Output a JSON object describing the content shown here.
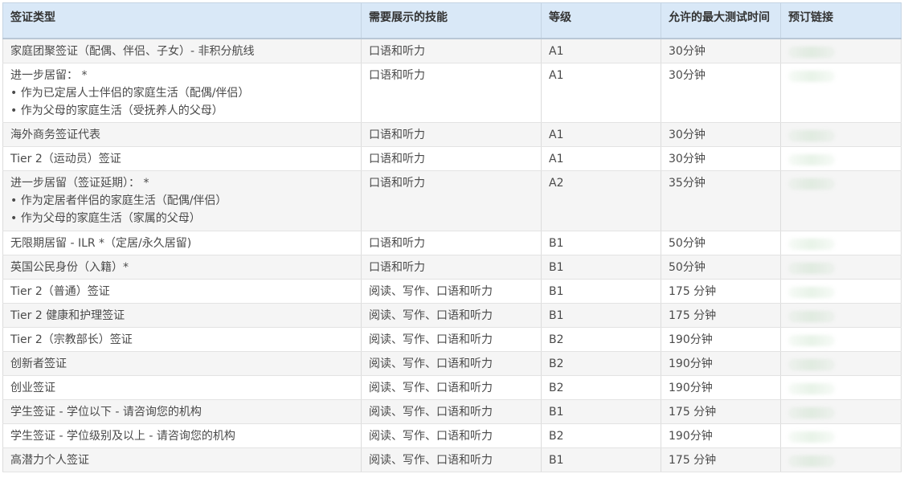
{
  "table": {
    "headers": [
      "签证类型",
      "需要展示的技能",
      "等级",
      "允许的最大测试时间",
      "预订链接"
    ],
    "rows": [
      {
        "type_lines": [
          "家庭团聚签证（配偶、伴侣、子女）- 非积分航线"
        ],
        "skills": "口语和听力",
        "level": "A1",
        "time": "30分钟"
      },
      {
        "type_lines": [
          "进一步居留： *",
          "• 作为已定居人士伴侣的家庭生活（配偶/伴侣）",
          "• 作为父母的家庭生活（受抚养人的父母）"
        ],
        "skills": "口语和听力",
        "level": "A1",
        "time": "30分钟"
      },
      {
        "type_lines": [
          "海外商务签证代表"
        ],
        "skills": "口语和听力",
        "level": "A1",
        "time": "30分钟"
      },
      {
        "type_lines": [
          "Tier 2（运动员）签证"
        ],
        "skills": "口语和听力",
        "level": "A1",
        "time": "30分钟"
      },
      {
        "type_lines": [
          "进一步居留（签证延期）： *",
          "• 作为定居者伴侣的家庭生活（配偶/伴侣）",
          "• 作为父母的家庭生活（家属的父母）"
        ],
        "skills": "口语和听力",
        "level": "A2",
        "time": "35分钟"
      },
      {
        "type_lines": [
          "无限期居留 - ILR *（定居/永久居留)"
        ],
        "skills": "口语和听力",
        "level": "B1",
        "time": "50分钟"
      },
      {
        "type_lines": [
          "英国公民身份（入籍）*"
        ],
        "skills": "口语和听力",
        "level": "B1",
        "time": "50分钟"
      },
      {
        "type_lines": [
          "Tier 2（普通）签证"
        ],
        "skills": "阅读、写作、口语和听力",
        "level": "B1",
        "time": "175 分钟"
      },
      {
        "type_lines": [
          "Tier 2 健康和护理签证"
        ],
        "skills": "阅读、写作、口语和听力",
        "level": "B1",
        "time": "175 分钟"
      },
      {
        "type_lines": [
          "Tier 2（宗教部长）签证"
        ],
        "skills": "阅读、写作、口语和听力",
        "level": "B2",
        "time": "190分钟"
      },
      {
        "type_lines": [
          "创新者签证"
        ],
        "skills": "阅读、写作、口语和听力",
        "level": "B2",
        "time": "190分钟"
      },
      {
        "type_lines": [
          "创业签证"
        ],
        "skills": "阅读、写作、口语和听力",
        "level": "B2",
        "time": "190分钟"
      },
      {
        "type_lines": [
          "学生签证 - 学位以下 - 请咨询您的机构"
        ],
        "skills": "阅读、写作、口语和听力",
        "level": "B1",
        "time": "175 分钟"
      },
      {
        "type_lines": [
          "学生签证 - 学位级别及以上 - 请咨询您的机构"
        ],
        "skills": "阅读、写作、口语和听力",
        "level": "B2",
        "time": "190分钟"
      },
      {
        "type_lines": [
          "高潜力个人签证"
        ],
        "skills": "阅读、写作、口语和听力",
        "level": "B1",
        "time": "175 分钟"
      }
    ]
  },
  "colors": {
    "header_bg": "#d9e8f7",
    "row_alt_bg": "#f5f5f5",
    "text": "#4a4a4a"
  }
}
